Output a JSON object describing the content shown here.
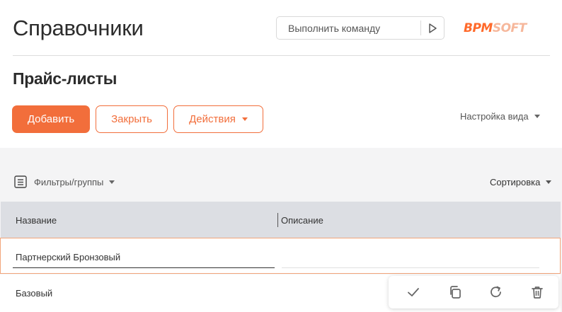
{
  "header": {
    "title": "Справочники",
    "command_placeholder": "Выполнить команду",
    "logo": {
      "part1": "BPM",
      "part2": "SOFT",
      "color_primary": "#ff6a2b",
      "color_secondary": "#f6b79b"
    }
  },
  "section": {
    "title": "Прайс-листы",
    "buttons": {
      "add": "Добавить",
      "close": "Закрыть",
      "actions": "Действия"
    },
    "view_settings": "Настройка вида"
  },
  "toolbar": {
    "filters_label": "Фильтры/группы",
    "sort_label": "Сортировка"
  },
  "grid": {
    "columns": [
      "Название",
      "Описание"
    ],
    "rows": [
      {
        "name": "Партнерский Бронзовый",
        "description": "",
        "editing": true
      },
      {
        "name": "Базовый",
        "description": ""
      }
    ],
    "row_actions": [
      "check-icon",
      "copy-icon",
      "refresh-icon",
      "trash-icon"
    ]
  },
  "colors": {
    "accent": "#f26e3b",
    "header_bg": "#dcdee3",
    "page_bg": "#f4f4f5"
  }
}
